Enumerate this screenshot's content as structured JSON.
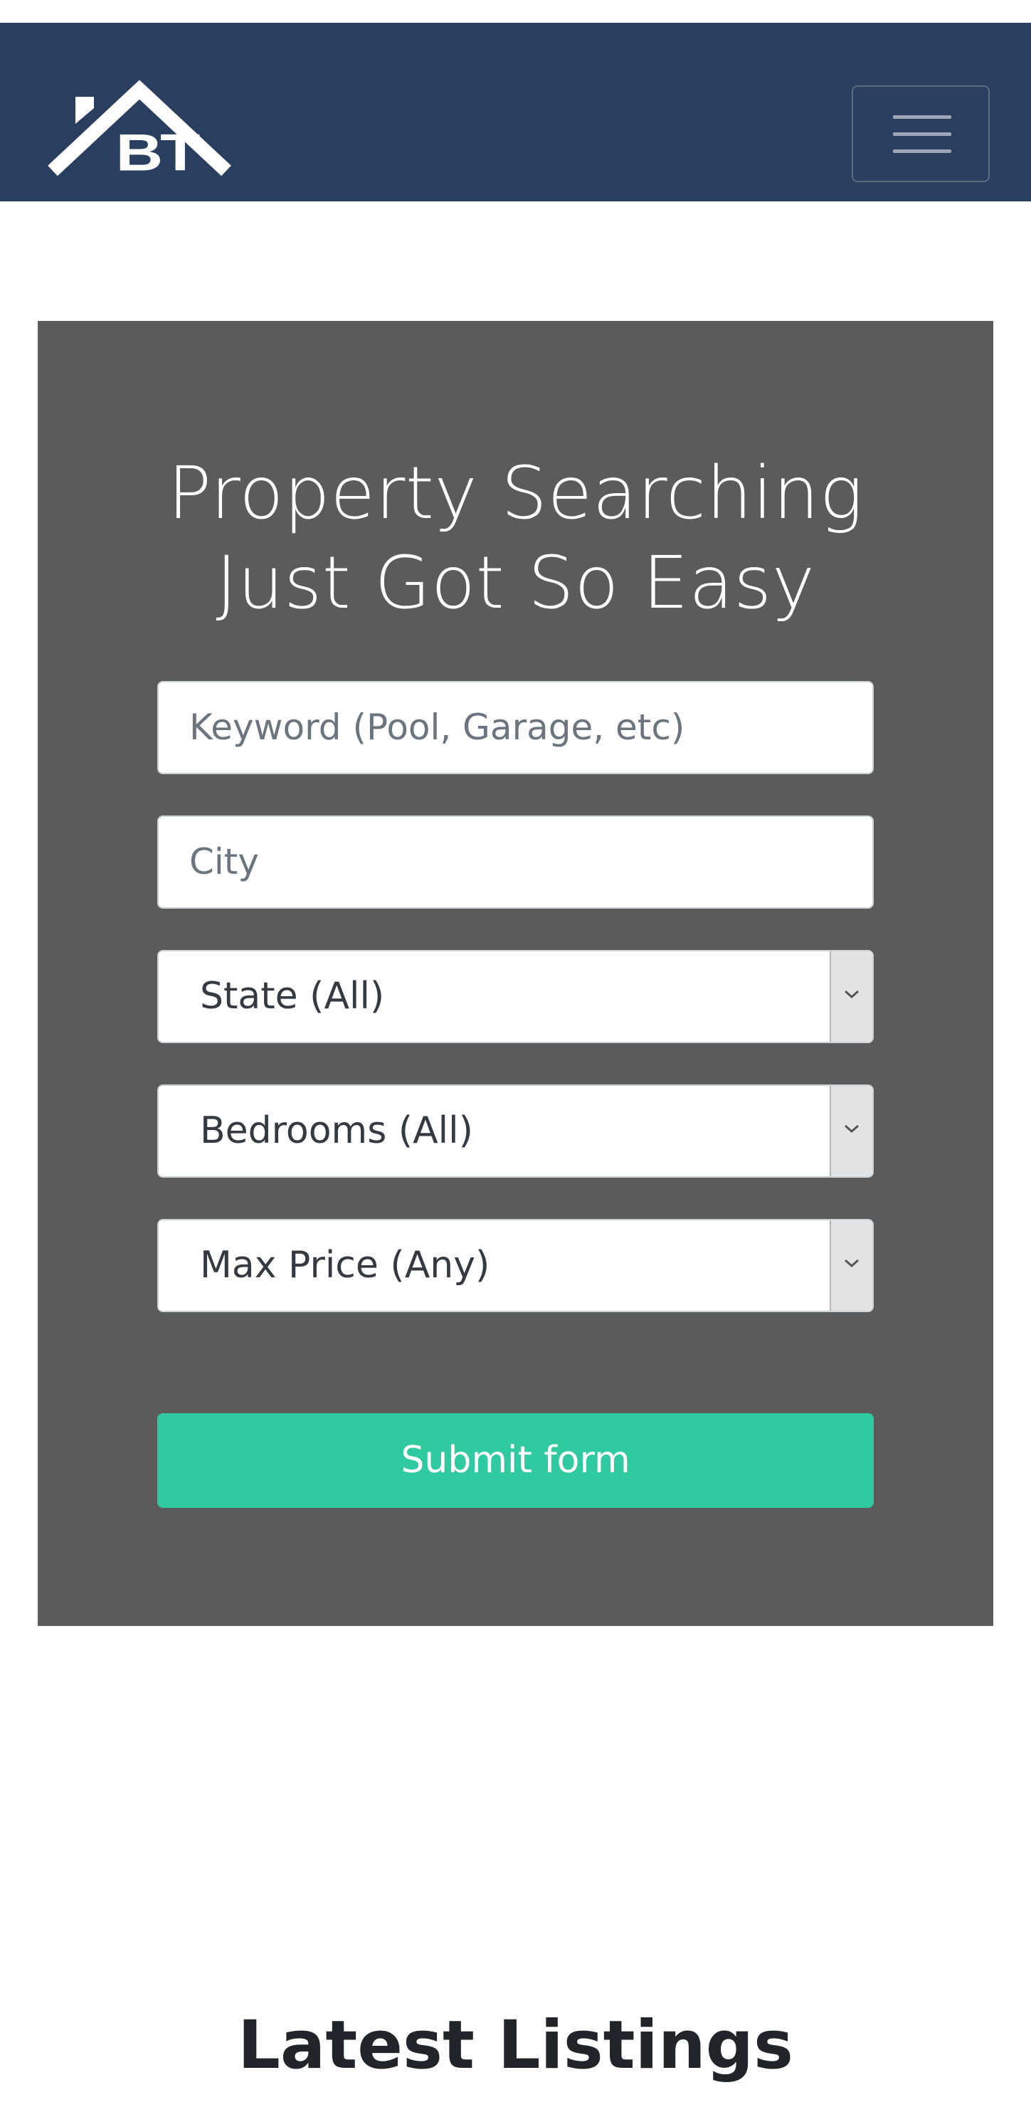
{
  "navbar": {
    "logo_text": "BT",
    "menu_icon": "hamburger-menu-icon"
  },
  "hero": {
    "title_line1": "Property Searching",
    "title_line2": "Just Got So Easy",
    "keyword_placeholder": "Keyword (Pool, Garage, etc)",
    "city_placeholder": "City",
    "state_select": "State (All)",
    "bedrooms_select": "Bedrooms (All)",
    "max_price_select": "Max Price (Any)",
    "submit_label": "Submit form"
  },
  "listings": {
    "heading": "Latest Listings"
  },
  "colors": {
    "navbar_bg": "#2a3f5f",
    "hero_bg": "#5b5b5b",
    "submit_bg": "#2fca9f"
  }
}
